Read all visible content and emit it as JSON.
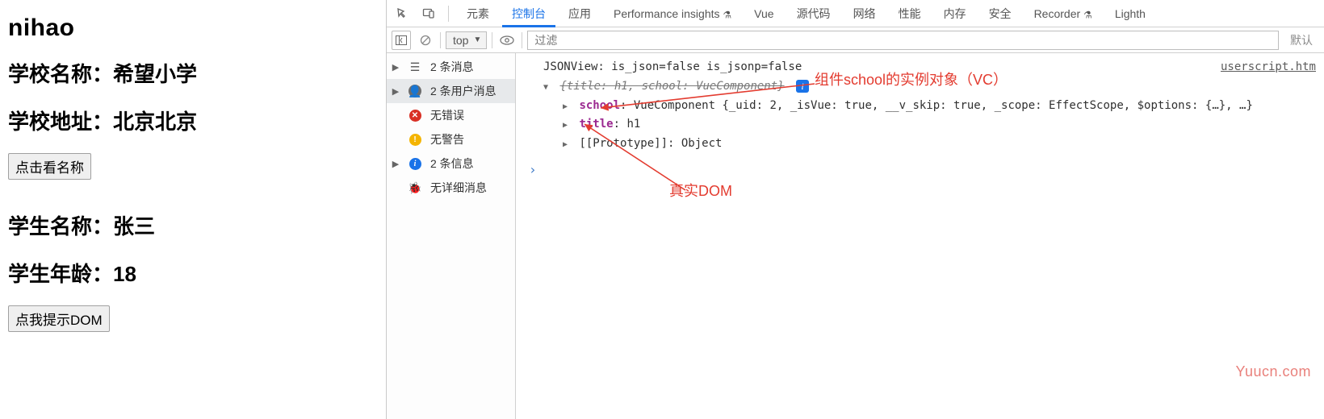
{
  "app": {
    "heading": "nihao",
    "school_name_label": "学校名称：",
    "school_name_value": "希望小学",
    "school_addr_label": "学校地址：",
    "school_addr_value": "北京北京",
    "btn_show_name": "点击看名称",
    "student_name_label": "学生名称：",
    "student_name_value": "张三",
    "student_age_label": "学生年龄：",
    "student_age_value": "18",
    "btn_show_dom": "点我提示DOM"
  },
  "devtools": {
    "tabs": {
      "elements": "元素",
      "console": "控制台",
      "application": "应用",
      "perf_insights": "Performance insights",
      "vue": "Vue",
      "sources": "源代码",
      "network": "网络",
      "performance": "性能",
      "memory": "内存",
      "security": "安全",
      "recorder": "Recorder",
      "lighthouse": "Lighth"
    },
    "toolbar": {
      "context": "top",
      "filter_placeholder": "过滤",
      "default_levels": "默认"
    },
    "sidebar": {
      "messages": "2 条消息",
      "user_messages": "2 条用户消息",
      "no_errors": "无错误",
      "no_warnings": "无警告",
      "info": "2 条信息",
      "no_verbose": "无详细消息"
    },
    "console": {
      "jsonview": "JSONView: is_json=false is_jsonp=false",
      "summary": "{title: h1, school: VueComponent}",
      "school_key": "school",
      "school_value": "VueComponent {_uid: 2, _isVue: true, __v_skip: true, _scope: EffectScope, $options: {…}, …}",
      "title_key": "title",
      "title_value": "h1",
      "proto_key": "[[Prototype]]",
      "proto_value": "Object",
      "source_link": "userscript.htm"
    }
  },
  "annotations": {
    "vc": "组件school的实例对象（VC）",
    "dom": "真实DOM"
  },
  "watermark": "Yuucn.com"
}
